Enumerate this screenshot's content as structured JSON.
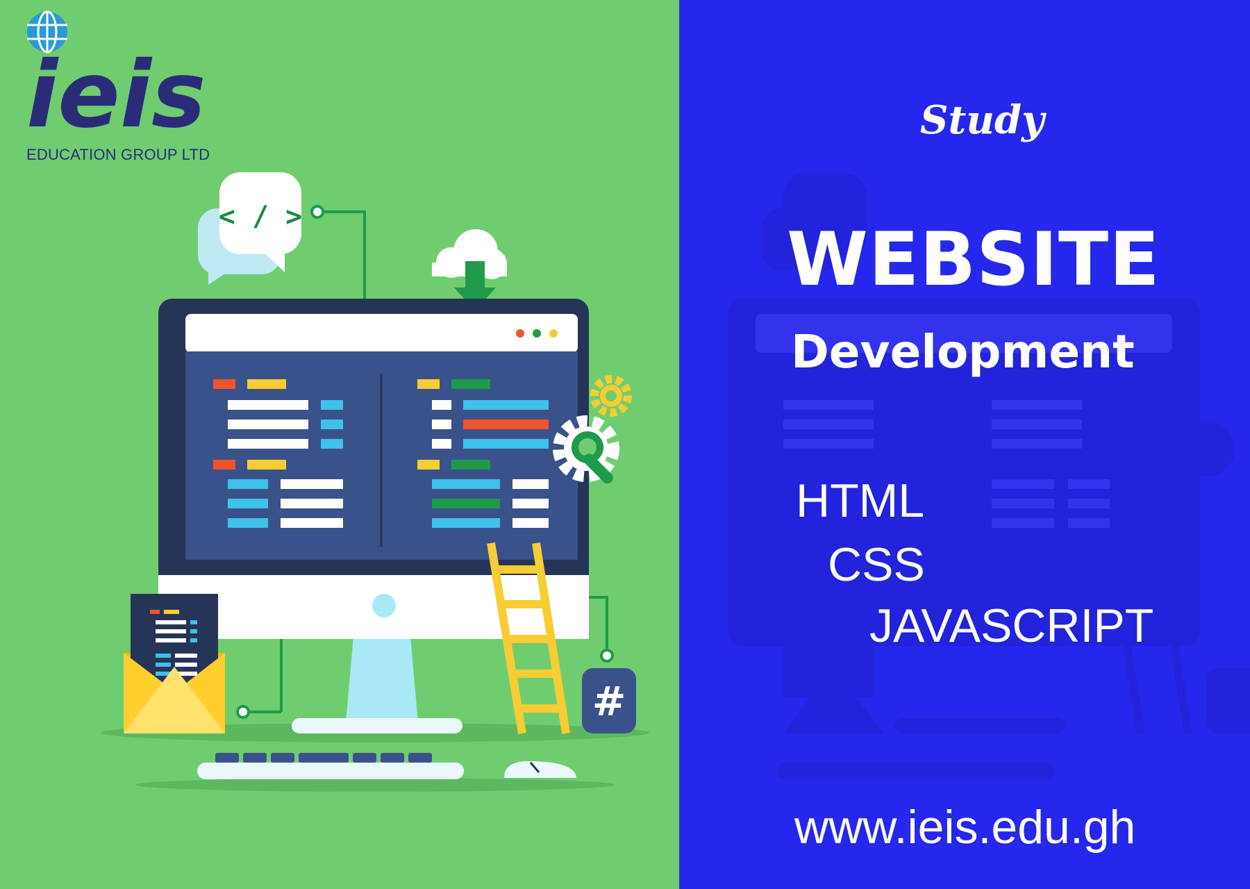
{
  "brand": {
    "logo_text": "ieis",
    "subtitle": "EDUCATION GROUP LTD"
  },
  "illustration": {
    "code_tag": "< / >",
    "hash_symbol": "#"
  },
  "promo": {
    "kicker": "Study",
    "headline": "WEBSITE",
    "subheadline": "Development",
    "skills": [
      "HTML",
      "CSS",
      "JAVASCRIPT"
    ],
    "url": "www.ieis.edu.gh"
  },
  "colors": {
    "left_panel": "#6fcd70",
    "right_panel": "#2627ec",
    "brand_navy": "#2b2c78",
    "monitor_dark": "#2c3a5e",
    "screen_code_bg": "#3a528a",
    "accent_yellow": "#f7cd33",
    "accent_green": "#1e9a4a"
  }
}
